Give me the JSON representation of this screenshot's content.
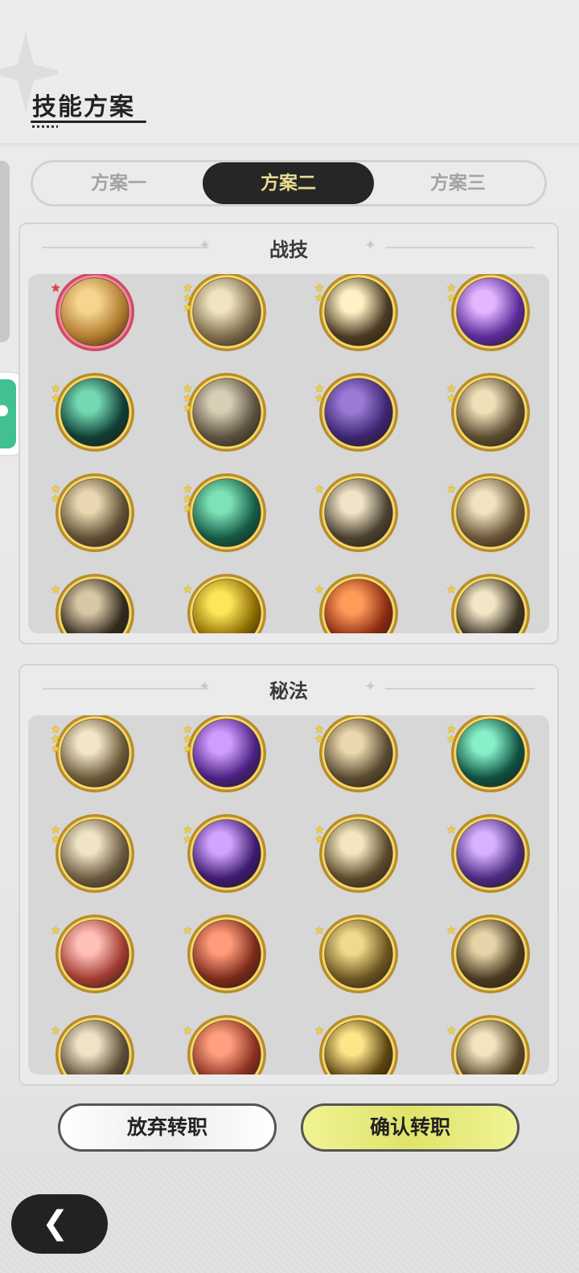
{
  "header": {
    "title": "技能方案"
  },
  "tabs": [
    {
      "label": "方案一",
      "active": false
    },
    {
      "label": "方案二",
      "active": true
    },
    {
      "label": "方案三",
      "active": false
    }
  ],
  "sections": [
    {
      "label": "战技",
      "skills": [
        {
          "icon": "golden-swirl-skill-icon",
          "stars": 1,
          "star_color": "#e83a4a",
          "ring": "red",
          "palette": [
            "#f7d58f",
            "#b07a2d"
          ]
        },
        {
          "icon": "sparkle-sword-skill-icon",
          "stars": 3,
          "palette": [
            "#efe3c0",
            "#7d6a4a"
          ]
        },
        {
          "icon": "light-burst-skill-icon",
          "stars": 2,
          "palette": [
            "#fff1c4",
            "#4a3a22"
          ]
        },
        {
          "icon": "purple-heart-skill-icon",
          "stars": 2,
          "palette": [
            "#e3b6ff",
            "#5a2a9a"
          ]
        },
        {
          "icon": "teal-slash-skill-icon",
          "stars": 2,
          "palette": [
            "#74d9b2",
            "#0f3d36"
          ]
        },
        {
          "icon": "phantom-charge-skill-icon",
          "stars": 3,
          "palette": [
            "#d8cdb5",
            "#5c5040"
          ]
        },
        {
          "icon": "purple-claw-skill-icon",
          "stars": 2,
          "palette": [
            "#9b7ad6",
            "#3c2470"
          ]
        },
        {
          "icon": "gauntlet-sweep-skill-icon",
          "stars": 2,
          "palette": [
            "#f0e0b8",
            "#5a4a30"
          ]
        },
        {
          "icon": "crescent-blade-skill-icon",
          "stars": 2,
          "palette": [
            "#e8d7b0",
            "#5f4f35"
          ]
        },
        {
          "icon": "green-arrows-skill-icon",
          "stars": 3,
          "palette": [
            "#7de3b6",
            "#145a45"
          ]
        },
        {
          "icon": "vortex-ring-skill-icon",
          "stars": 1,
          "palette": [
            "#efe4c7",
            "#4b4030"
          ]
        },
        {
          "icon": "whirlwind-skill-icon",
          "stars": 1,
          "palette": [
            "#f1e3c1",
            "#6a5638"
          ]
        },
        {
          "icon": "dark-spikes-skill-icon",
          "stars": 1,
          "palette": [
            "#d7c7a6",
            "#332a1e"
          ]
        },
        {
          "icon": "golden-up-arrows-skill-icon",
          "stars": 1,
          "palette": [
            "#ffe55a",
            "#8a6a00"
          ]
        },
        {
          "icon": "red-crest-skill-icon",
          "stars": 1,
          "palette": [
            "#ff9a5a",
            "#8a2a10"
          ]
        },
        {
          "icon": "shadow-strike-skill-icon",
          "stars": 1,
          "palette": [
            "#f2e6c6",
            "#3d3424"
          ]
        }
      ]
    },
    {
      "label": "秘法",
      "skills": [
        {
          "icon": "eye-skill-icon",
          "stars": 3,
          "palette": [
            "#f2e6c8",
            "#6b5a3a"
          ]
        },
        {
          "icon": "violet-flame-skill-icon",
          "stars": 3,
          "palette": [
            "#cf9cff",
            "#4a2080"
          ]
        },
        {
          "icon": "armor-skill-icon",
          "stars": 2,
          "palette": [
            "#e9d7ad",
            "#5a4a30"
          ]
        },
        {
          "icon": "heal-beacon-skill-icon",
          "stars": 2,
          "palette": [
            "#86f0c8",
            "#0f5040"
          ]
        },
        {
          "icon": "sword-up-skill-icon",
          "stars": 2,
          "palette": [
            "#f0e4c8",
            "#6a5a40"
          ]
        },
        {
          "icon": "violet-figure-skill-icon",
          "stars": 2,
          "palette": [
            "#d2a4ff",
            "#3d1a70"
          ]
        },
        {
          "icon": "heal-cloak-skill-icon",
          "stars": 2,
          "palette": [
            "#f4e6be",
            "#5a4a2c"
          ]
        },
        {
          "icon": "violet-orb-skill-icon",
          "stars": 1,
          "palette": [
            "#d8b2ff",
            "#4a2a80"
          ]
        },
        {
          "icon": "red-sword-heal-skill-icon",
          "stars": 1,
          "palette": [
            "#ffc0b8",
            "#a03a30"
          ]
        },
        {
          "icon": "red-armor-skill-icon",
          "stars": 1,
          "palette": [
            "#ff9a7a",
            "#7a2a1a"
          ]
        },
        {
          "icon": "golden-guardian-skill-icon",
          "stars": 1,
          "palette": [
            "#f0d98a",
            "#6a5520"
          ]
        },
        {
          "icon": "shadow-dragon-skill-icon",
          "stars": 1,
          "palette": [
            "#e6d4a8",
            "#4a3a22"
          ]
        },
        {
          "icon": "sword-down-skill-icon",
          "stars": 1,
          "palette": [
            "#efe2c6",
            "#5c4e38"
          ]
        },
        {
          "icon": "red-shield-skill-icon",
          "stars": 1,
          "palette": [
            "#ff9f80",
            "#8a3020"
          ]
        },
        {
          "icon": "demon-aura-skill-icon",
          "stars": 1,
          "palette": [
            "#ffe58a",
            "#5a4410"
          ]
        },
        {
          "icon": "spiral-eye-skill-icon",
          "stars": 1,
          "palette": [
            "#f3e5c0",
            "#5a4a2a"
          ]
        }
      ]
    }
  ],
  "buttons": {
    "abandon": "放弃转职",
    "confirm": "确认转职"
  },
  "nav": {
    "back_icon": "back-chevron-icon"
  }
}
